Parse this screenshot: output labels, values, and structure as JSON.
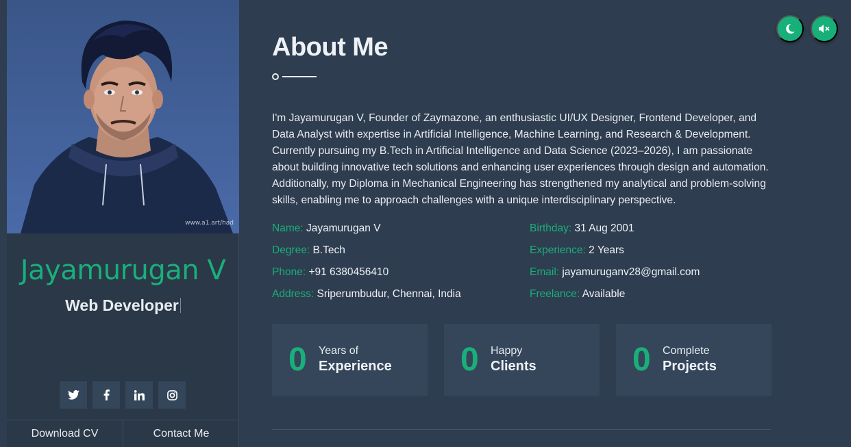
{
  "sidebar": {
    "photo_watermark": "www.a1.art/had",
    "name": "Jayamurugan V",
    "role": "Web Developer",
    "socials": [
      {
        "icon": "twitter-icon"
      },
      {
        "icon": "facebook-icon"
      },
      {
        "icon": "linkedin-icon"
      },
      {
        "icon": "instagram-icon"
      }
    ],
    "download_cv": "Download CV",
    "contact_me": "Contact Me"
  },
  "main": {
    "title": "About Me",
    "bio": "I'm Jayamurugan V, Founder of Zaymazone, an enthusiastic UI/UX Designer, Frontend Developer, and Data Analyst with expertise in Artificial Intelligence, Machine Learning, and Research & Development. Currently pursuing my B.Tech in Artificial Intelligence and Data Science (2023–2026), I am passionate about building innovative tech solutions and enhancing user experiences through design and automation. Additionally, my Diploma in Mechanical Engineering has strengthened my analytical and problem-solving skills, enabling me to approach challenges with a unique interdisciplinary perspective.",
    "info": {
      "name_label": "Name:",
      "name_value": "Jayamurugan V",
      "birthday_label": "Birthday:",
      "birthday_value": "31 Aug 2001",
      "degree_label": "Degree:",
      "degree_value": "B.Tech",
      "experience_label": "Experience:",
      "experience_value": "2 Years",
      "phone_label": "Phone:",
      "phone_value": "+91 6380456410",
      "email_label": "Email:",
      "email_value": "jayamuruganv28@gmail.com",
      "address_label": "Address:",
      "address_value": "Sriperumbudur, Chennai, India",
      "freelance_label": "Freelance:",
      "freelance_value": "Available"
    },
    "stats": [
      {
        "number": "0",
        "line1": "Years of",
        "line2": "Experience"
      },
      {
        "number": "0",
        "line1": "Happy",
        "line2": "Clients"
      },
      {
        "number": "0",
        "line1": "Complete",
        "line2": "Projects"
      }
    ]
  },
  "controls": {
    "theme_icon": "moon-icon",
    "sound_icon": "volume-mute-icon"
  },
  "colors": {
    "accent": "#1aaf7a",
    "background": "#2e3d4f",
    "card": "#35465a"
  }
}
